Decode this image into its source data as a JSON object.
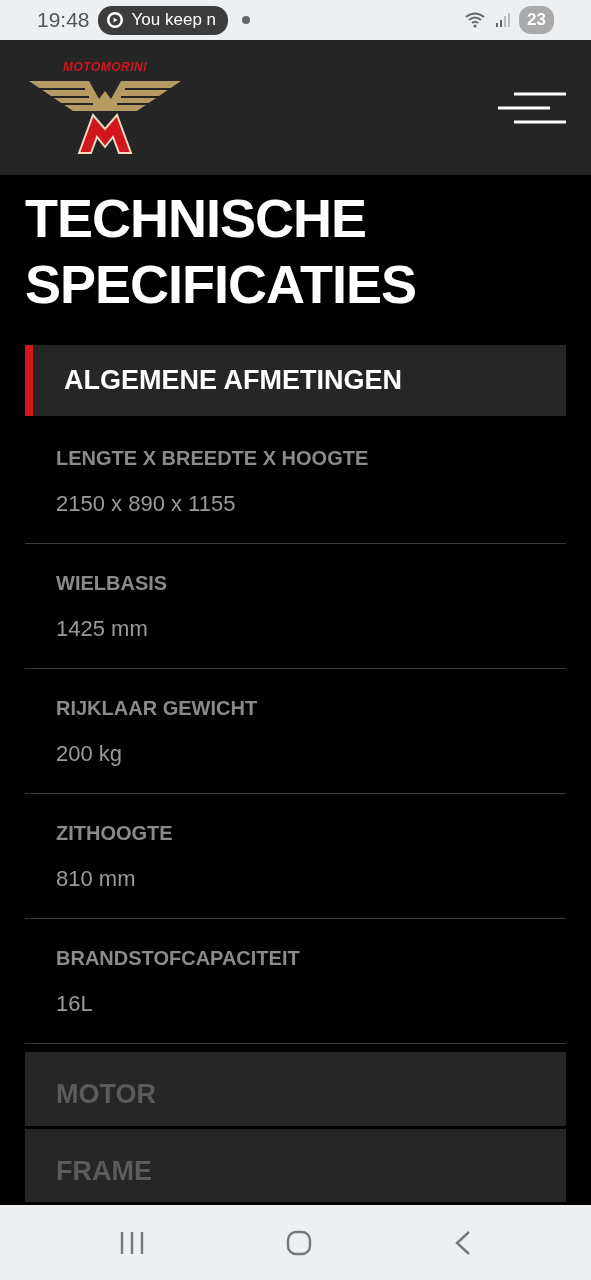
{
  "status_bar": {
    "time": "19:48",
    "notification": "You keep n",
    "battery": "23"
  },
  "header": {
    "logo_text": "MOTOMORINI"
  },
  "title": "TECHNISCHE SPECIFICATIES",
  "sections": [
    {
      "title": "ALGEMENE AFMETINGEN",
      "expanded": true,
      "specs": [
        {
          "label": "LENGTE X BREEDTE X HOOGTE",
          "value": "2150 x 890 x 1155"
        },
        {
          "label": "WIELBASIS",
          "value": "1425 mm"
        },
        {
          "label": "RIJKLAAR GEWICHT",
          "value": "200 kg"
        },
        {
          "label": "ZITHOOGTE",
          "value": "810 mm"
        },
        {
          "label": "BRANDSTOFCAPACITEIT",
          "value": "16L"
        }
      ]
    },
    {
      "title": "MOTOR",
      "expanded": false
    },
    {
      "title": "FRAME",
      "expanded": false
    }
  ]
}
